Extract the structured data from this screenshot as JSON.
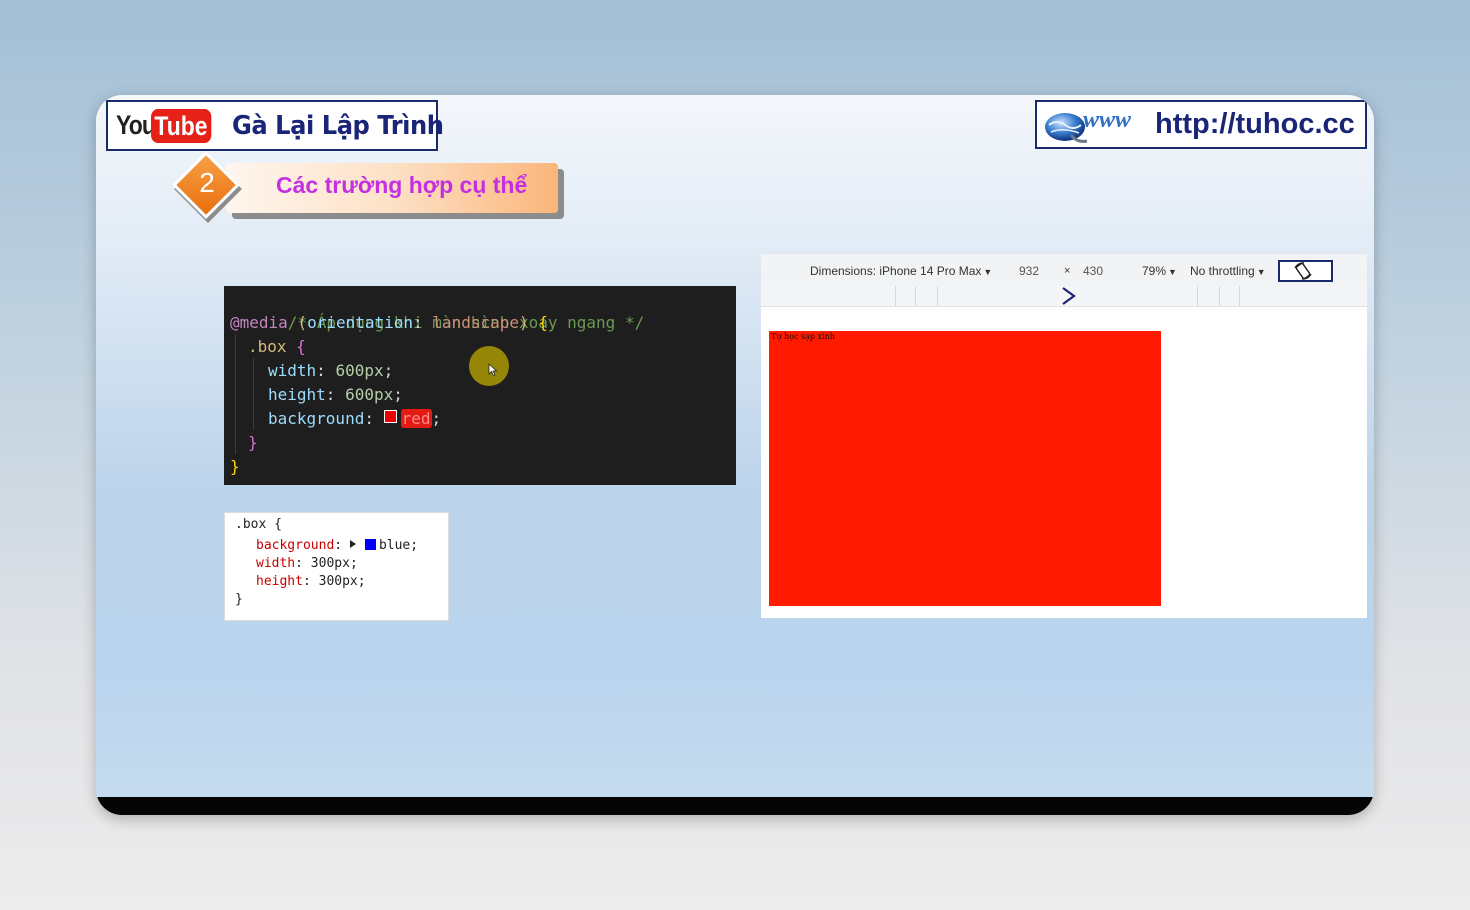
{
  "branding": {
    "youtube_logo_you": "You",
    "youtube_logo_tube": "Tube",
    "channel_name": "Gà Lại Lập Trình",
    "www_logo_text": "www",
    "site_url": "http://tuhoc.cc"
  },
  "section": {
    "number": "2",
    "title": "Các trường hợp cụ thể"
  },
  "code_editor": {
    "comment": "/* Áp dụng khi màn hình xoay ngang */",
    "at_rule": "@media",
    "media_open_paren": " (",
    "media_feature": "orientation",
    "media_colon": ": ",
    "media_value": "landscape",
    "media_close_paren": ")",
    "media_open_brace": " {",
    "selector": ".box",
    "selector_open_brace": " {",
    "width_prop": "width",
    "width_value": "600px",
    "height_prop": "height",
    "height_value": "600px",
    "background_prop": "background",
    "background_value": "red",
    "colon": ": ",
    "semicolon": ";",
    "inner_close_brace": "}",
    "outer_close_brace": "}"
  },
  "css_rule_panel": {
    "selector": ".box {",
    "background_prop": "background",
    "background_value": "blue",
    "width_prop": "width",
    "width_value": "300px",
    "height_prop": "height",
    "height_value": "300px",
    "colon": ": ",
    "semicolon": ";",
    "close_brace": "}"
  },
  "device_toolbar": {
    "dimensions_label": "Dimensions: iPhone 14 Pro Max",
    "width": "932",
    "times": "×",
    "height": "430",
    "zoom": "79%",
    "throttling": "No throttling",
    "dropdown_arrow": "▼"
  },
  "preview": {
    "box_text": "Tự học sạp xình",
    "box_color": "#ff1a00"
  },
  "colors": {
    "brand_navy": "#1a2578",
    "accent_orange": "#e96f0c",
    "title_magenta": "#c42fe3",
    "youtube_red": "#e62117"
  }
}
